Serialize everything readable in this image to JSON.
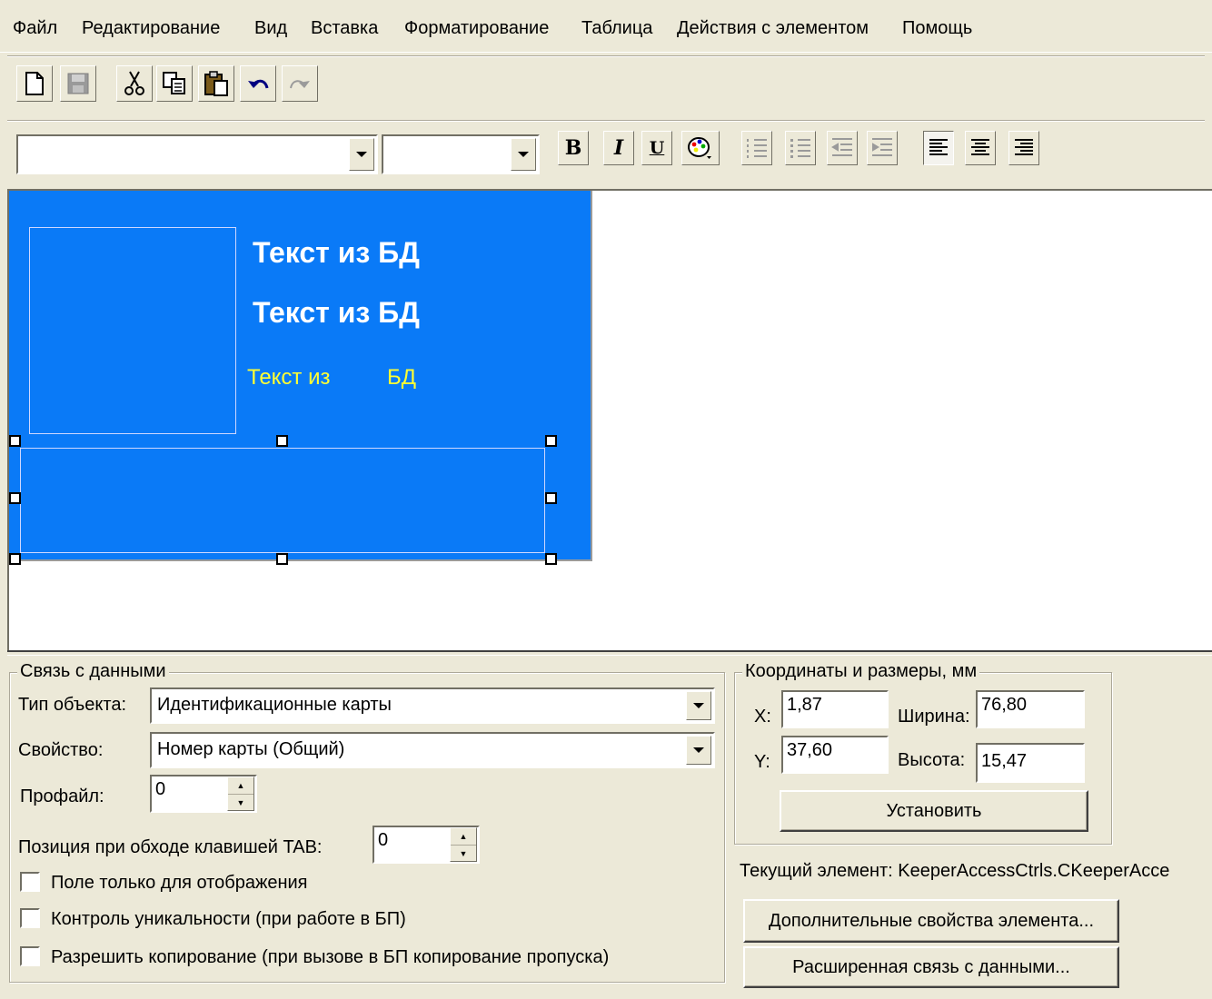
{
  "menu": {
    "items": [
      "Файл",
      "Редактирование",
      "Вид",
      "Вставка",
      "Форматирование",
      "Таблица",
      "Действия с элементом",
      "Помощь"
    ]
  },
  "toolbar": {
    "icons": [
      "new-file-icon",
      "save-icon",
      "cut-icon",
      "copy-icon",
      "paste-icon",
      "undo-icon",
      "redo-icon"
    ]
  },
  "format_bar": {
    "font_value": "",
    "size_value": "",
    "bold_label": "B",
    "italic_label": "I",
    "underline_label": "U"
  },
  "card": {
    "background": "#0a7af7",
    "line1": "Текст из БД",
    "line2": "Текст из БД",
    "line3_part1": "Текст из",
    "line3_part2": "БД"
  },
  "data_link": {
    "title": "Связь с данными",
    "object_type_label": "Тип объекта:",
    "object_type_value": "Идентификационные карты",
    "property_label": "Свойство:",
    "property_value": "Номер карты (Общий)",
    "profile_label": "Профайл:",
    "profile_value": "0",
    "tab_position_label": "Позиция при обходе клавишей TAB:",
    "tab_position_value": "0",
    "checkboxes": [
      {
        "label": "Поле только для отображения",
        "checked": false
      },
      {
        "label": "Контроль уникальности (при работе в БП)",
        "checked": false
      },
      {
        "label": "Разрешить копирование (при вызове в БП копирование пропуска)",
        "checked": false
      }
    ]
  },
  "coords": {
    "title": "Координаты и размеры, мм",
    "x_label": "X:",
    "x_value": "1,87",
    "y_label": "Y:",
    "y_value": "37,60",
    "width_label": "Ширина:",
    "width_value": "76,80",
    "height_label": "Высота:",
    "height_value": "15,47",
    "set_button": "Установить"
  },
  "current_element": {
    "text": "Текущий элемент:  KeeperAccessCtrls.CKeeperAcce"
  },
  "buttons": {
    "extra_props": "Дополнительные свойства элемента...",
    "advanced_link": "Расширенная связь с данными..."
  }
}
